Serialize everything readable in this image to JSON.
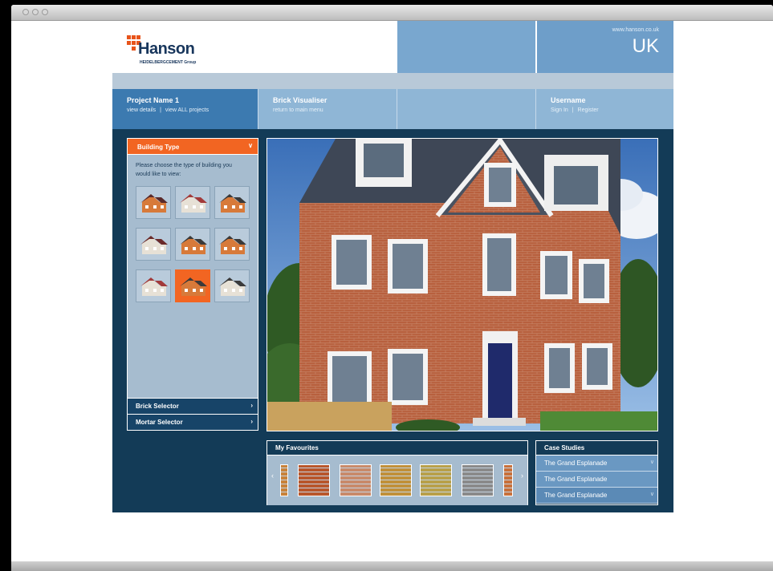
{
  "header": {
    "logo_word": "Hanson",
    "logo_sub": "HEIDELBERGCEMENT Group",
    "site_url": "www.hanson.co.uk",
    "country": "UK"
  },
  "nav": {
    "project": {
      "title": "Project Name 1",
      "link1": "view details",
      "sep": "|",
      "link2": "view ALL projects"
    },
    "app": {
      "title": "Brick Visualiser",
      "link": "return to main menu"
    },
    "user": {
      "title": "Username",
      "link1": "Sign In",
      "sep": "|",
      "link2": "Register"
    }
  },
  "sidebar": {
    "building_type_label": "Building Type",
    "building_type_help": "Please choose the type of building you would like to view:",
    "brick_selector_label": "Brick Selector",
    "mortar_selector_label": "Mortar Selector",
    "selected_index": 7
  },
  "favourites": {
    "title": "My Favourites",
    "swatch_colors": [
      "#c8823a",
      "#b8562c",
      "#c88a6a",
      "#c0903a",
      "#b8a04a",
      "#8a8a8a",
      "#c8703a"
    ]
  },
  "case_studies": {
    "title": "Case Studies",
    "items": [
      "The Grand Esplanade",
      "The Grand Esplanade",
      "The Grand Esplanade"
    ]
  },
  "colors": {
    "accent": "#f26522",
    "navy": "#133b57",
    "brand_blue": "#3c7ab0"
  }
}
